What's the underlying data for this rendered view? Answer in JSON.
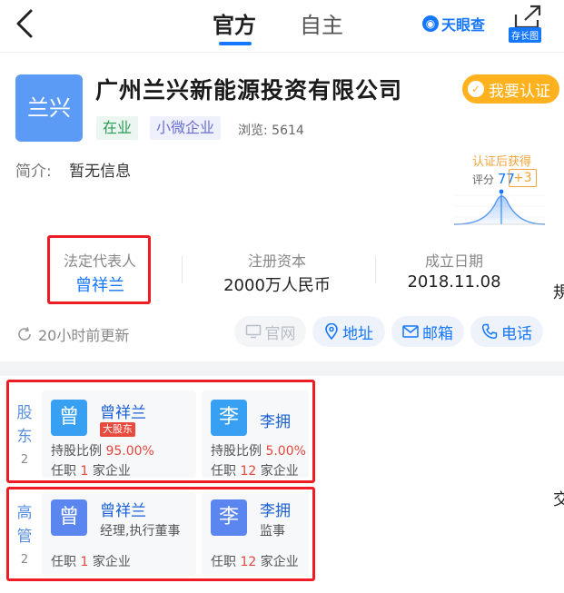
{
  "nav": {
    "tab_official": "官方",
    "tab_self": "自主",
    "brand": "天眼查",
    "long_image": "存长图"
  },
  "company": {
    "logo_text": "兰兴",
    "name": "广州兰兴新能源投资有限公司",
    "certify_label": "我要认证",
    "status_tag": "在业",
    "size_tag": "小微企业",
    "views_label": "浏览:",
    "views": "5614",
    "intro_label": "简介:",
    "intro_value": "暂无信息"
  },
  "score": {
    "title": "认证后获得",
    "label": "评分",
    "value": "77",
    "bonus": "+3"
  },
  "facts": {
    "legal_label": "法定代表人",
    "legal_value": "曾祥兰",
    "capital_label": "注册资本",
    "capital_value": "2000万人民币",
    "date_label": "成立日期",
    "date_value": "2018.11.08"
  },
  "update_text": "20小时前更新",
  "actions": {
    "website": "官网",
    "address": "地址",
    "email": "邮箱",
    "phone": "电话"
  },
  "shareholders": {
    "label_1": "股",
    "label_2": "东",
    "count": "2",
    "items": [
      {
        "avatar": "曾",
        "name": "曾祥兰",
        "badge": "大股东",
        "ratio_label": "持股比例",
        "ratio": "95.00%",
        "job_prefix": "任职",
        "job_count": "1",
        "job_suffix": "家企业"
      },
      {
        "avatar": "李",
        "name": "李拥",
        "ratio_label": "持股比例",
        "ratio": "5.00%",
        "job_prefix": "任职",
        "job_count": "12",
        "job_suffix": "家企业"
      }
    ]
  },
  "managers": {
    "label_1": "高",
    "label_2": "管",
    "count": "2",
    "items": [
      {
        "avatar": "曾",
        "name": "曾祥兰",
        "role": "经理,执行董事",
        "job_prefix": "任职",
        "job_count": "1",
        "job_suffix": "家企业"
      },
      {
        "avatar": "李",
        "name": "李拥",
        "role": "监事",
        "job_prefix": "任职",
        "job_count": "12",
        "job_suffix": "家企业"
      }
    ]
  },
  "edge_glyphs": [
    "規",
    "交"
  ]
}
